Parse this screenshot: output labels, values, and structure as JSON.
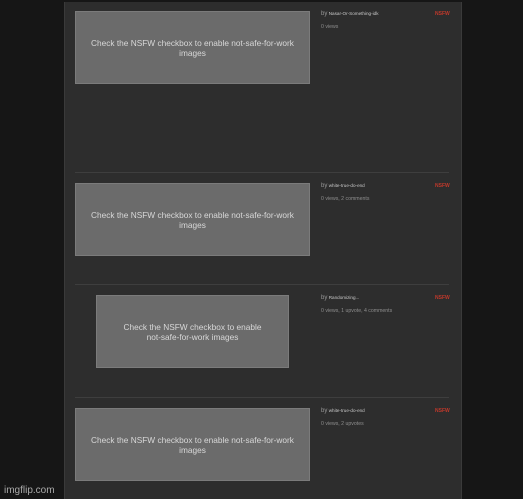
{
  "nsfw_placeholder": "Check the NSFW checkbox to enable not-safe-for-work images",
  "posts": [
    {
      "by": "by",
      "author": "Nasar-Or-Something-idk",
      "stats": "0 views",
      "tag": "NSFW"
    },
    {
      "by": "by",
      "author": "white-true-do-end",
      "stats": "0 views, 2 comments",
      "tag": "NSFW"
    },
    {
      "by": "by",
      "author": "Randomizing...",
      "stats": "0 views, 1 upvote, 4 comments",
      "tag": "NSFW"
    },
    {
      "by": "by",
      "author": "white-true-do-end",
      "stats": "0 views, 2 upvotes",
      "tag": "NSFW"
    }
  ],
  "watermark": "imgflip.com"
}
